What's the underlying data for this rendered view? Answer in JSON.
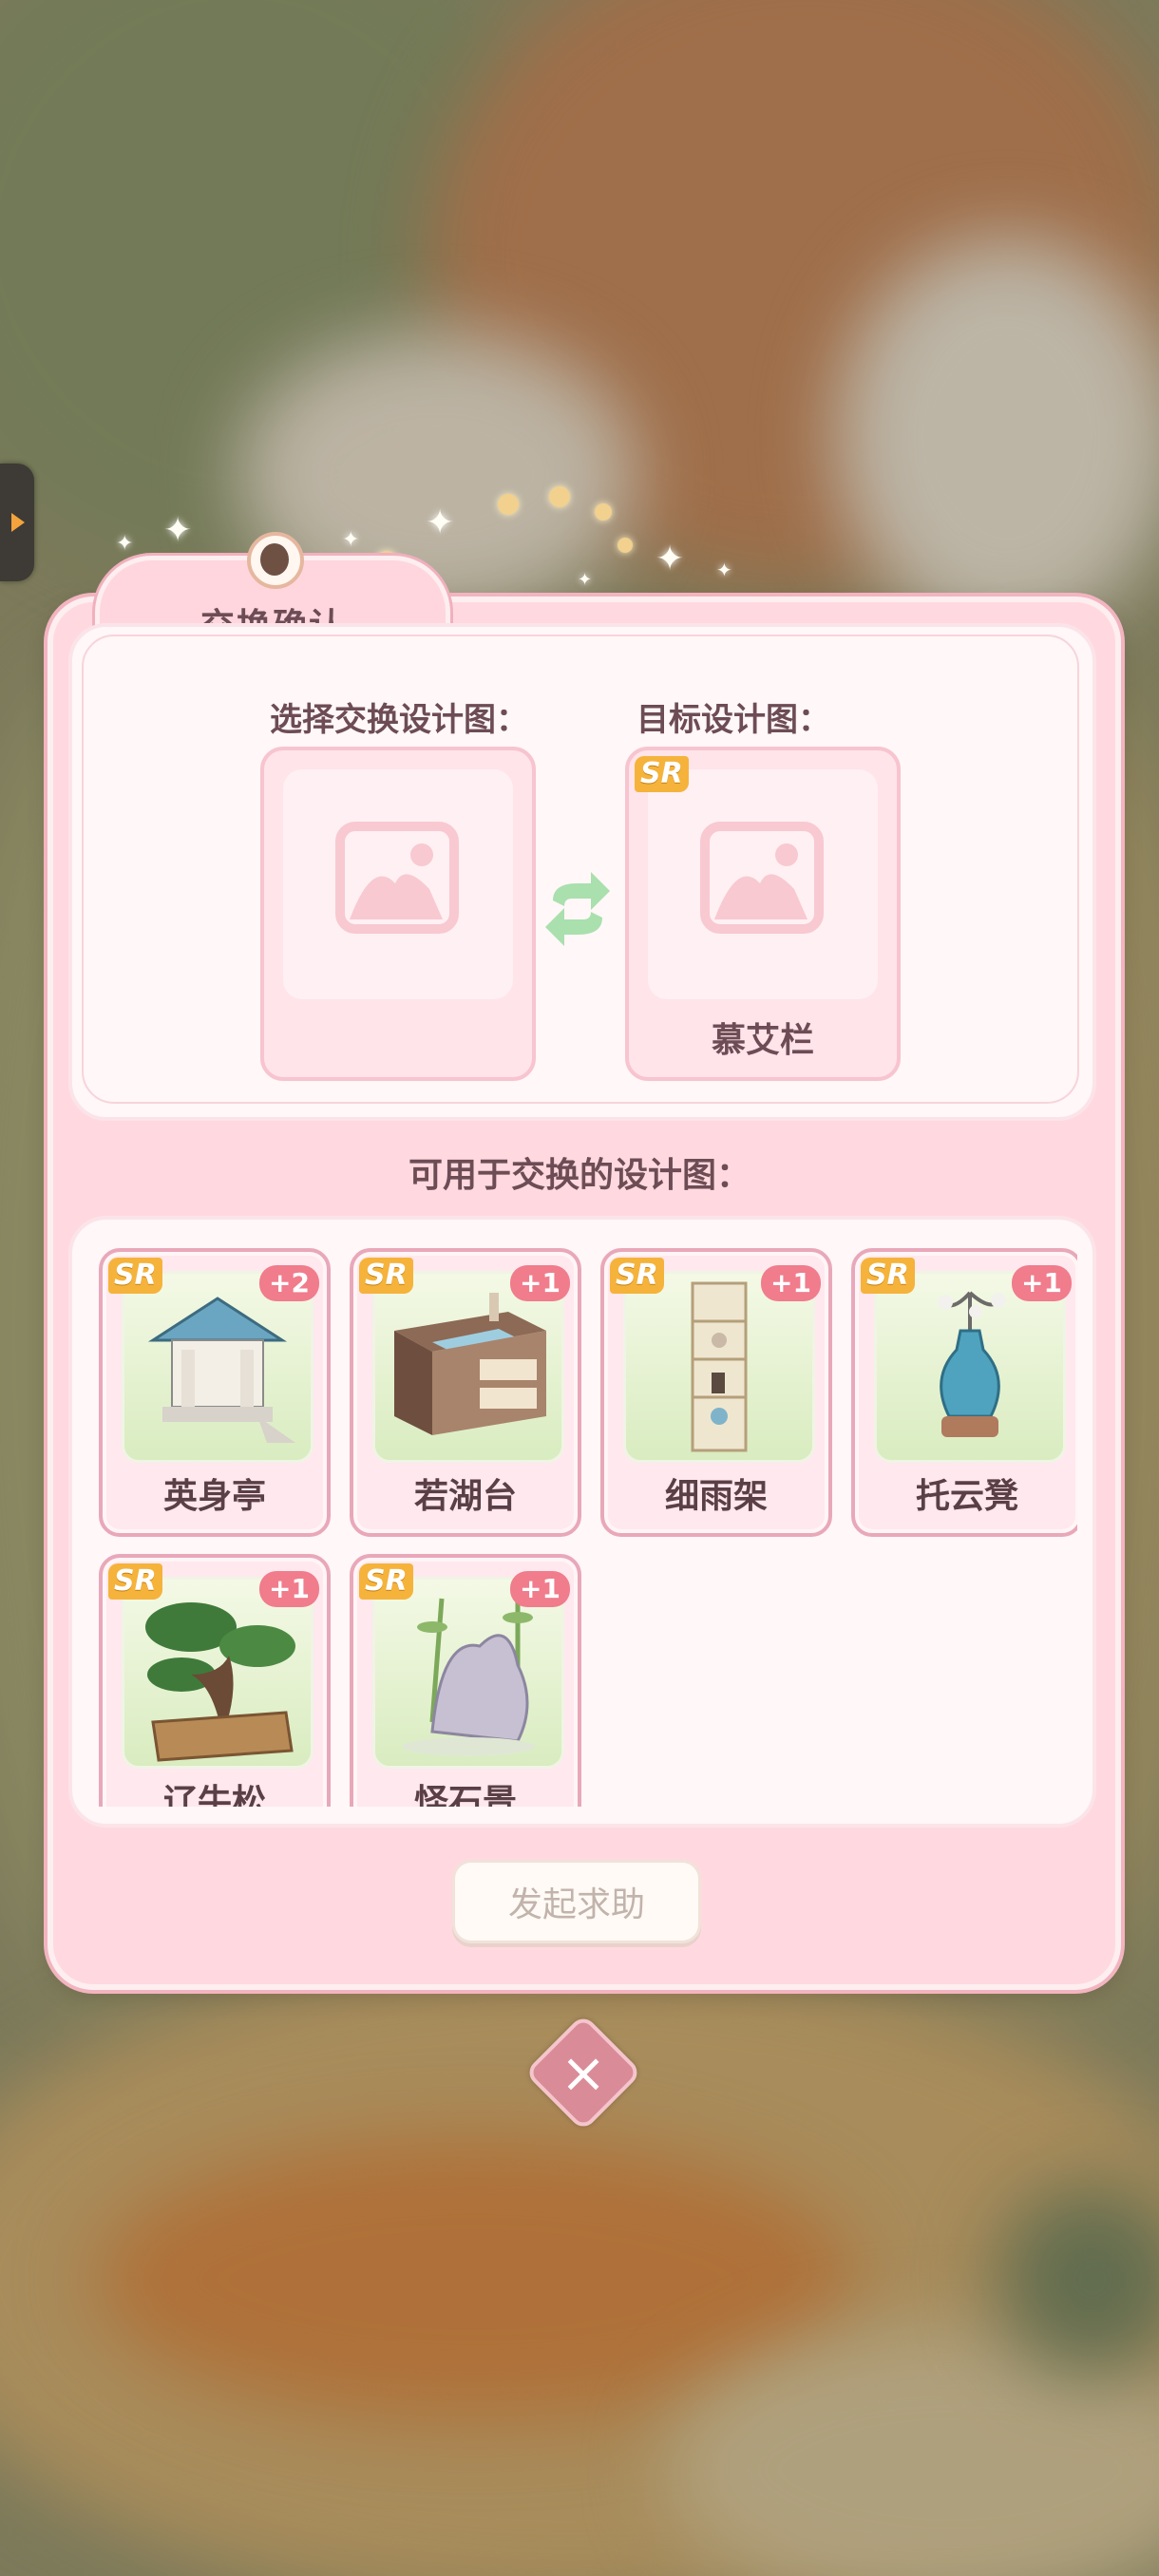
{
  "dialog": {
    "title": "交换确认",
    "select_label": "选择交换设计图：",
    "target_label": "目标设计图：",
    "target_rarity": "SR",
    "target_name": "慕艾栏",
    "available_label": "可用于交换的设计图：",
    "help_button": "发起求助"
  },
  "items": [
    {
      "rarity": "SR",
      "count": "+2",
      "name": "英身亭",
      "icon": "pavilion-icon"
    },
    {
      "rarity": "SR",
      "count": "+1",
      "name": "若湖台",
      "icon": "sink-counter-icon"
    },
    {
      "rarity": "SR",
      "count": "+1",
      "name": "细雨架",
      "icon": "shelf-icon"
    },
    {
      "rarity": "SR",
      "count": "+1",
      "name": "托云凳",
      "icon": "vase-icon"
    },
    {
      "rarity": "SR",
      "count": "+1",
      "name": "辽牛松",
      "icon": "bonsai-icon"
    },
    {
      "rarity": "SR",
      "count": "+1",
      "name": "怪石景",
      "icon": "rock-garden-icon"
    }
  ],
  "colors": {
    "panel_pink": "#ffd9df",
    "rarity_gold": "#f5b33b",
    "count_badge": "#f07c8c",
    "text_brown": "#6d4c55"
  }
}
